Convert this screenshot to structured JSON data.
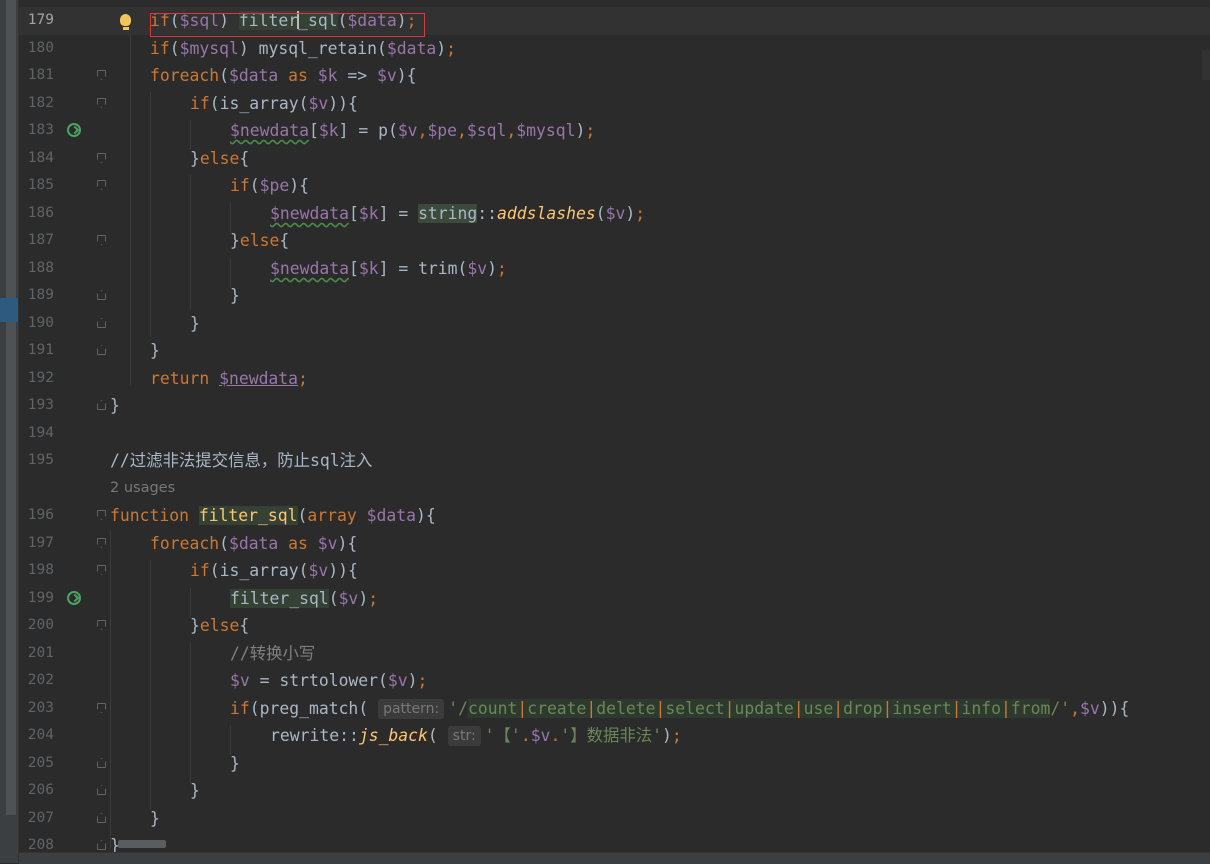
{
  "editor": {
    "usages_label": "2 usages",
    "hint_pattern": "pattern:",
    "hint_str": "str:",
    "lines": [
      {
        "n": "179"
      },
      {
        "n": "180"
      },
      {
        "n": "181"
      },
      {
        "n": "182"
      },
      {
        "n": "183"
      },
      {
        "n": "184"
      },
      {
        "n": "185"
      },
      {
        "n": "186"
      },
      {
        "n": "187"
      },
      {
        "n": "188"
      },
      {
        "n": "189"
      },
      {
        "n": "190"
      },
      {
        "n": "191"
      },
      {
        "n": "192"
      },
      {
        "n": "193"
      },
      {
        "n": "194"
      },
      {
        "n": "195"
      },
      {
        "n": "196"
      },
      {
        "n": "197"
      },
      {
        "n": "198"
      },
      {
        "n": "199"
      },
      {
        "n": "200"
      },
      {
        "n": "201"
      },
      {
        "n": "202"
      },
      {
        "n": "203"
      },
      {
        "n": "204"
      },
      {
        "n": "205"
      },
      {
        "n": "206"
      },
      {
        "n": "207"
      },
      {
        "n": "208"
      }
    ],
    "tokens": {
      "if": "if",
      "foreach": "foreach",
      "as": "as",
      "else": "else",
      "return": "return",
      "function": "function",
      "array": "array",
      "sql": "$sql",
      "mysql": "$mysql",
      "data": "$data",
      "k": "$k",
      "v": "$v",
      "pe": "$pe",
      "newdata": "$newdata",
      "filter_sql": "filter_sql",
      "mysql_retain": "mysql_retain",
      "is_array": "is_array",
      "p": "p",
      "string": "string",
      "addslashes": "addslashes",
      "trim": "trim",
      "strtolower": "strtolower",
      "preg_match": "preg_match",
      "rewrite": "rewrite",
      "js_back": "js_back",
      "comment195": "//过滤非法提交信息，防止sql注入",
      "comment201": "//转换小写",
      "regex_parts": [
        "count",
        "create",
        "delete",
        "select",
        "update",
        "use",
        "drop",
        "insert",
        "info",
        "from"
      ],
      "str_prefix": "'【'",
      "str_suffix": "'】数据非法'"
    }
  }
}
